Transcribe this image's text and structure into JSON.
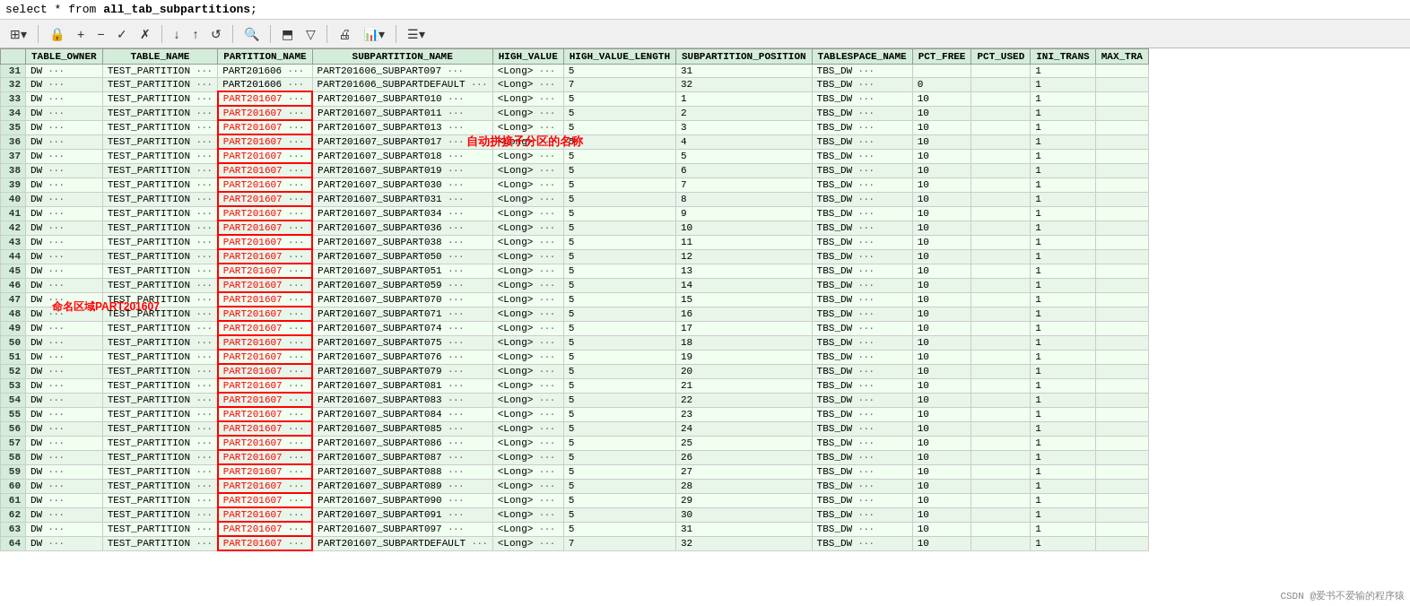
{
  "sql": {
    "text": "select * from all_tab_subpartitions;"
  },
  "toolbar": {
    "buttons": [
      {
        "id": "grid-btn",
        "icon": "⊞",
        "label": "grid"
      },
      {
        "id": "lock-btn",
        "icon": "🔒",
        "label": "lock"
      },
      {
        "id": "add-btn",
        "icon": "+",
        "label": "add"
      },
      {
        "id": "minus-btn",
        "icon": "−",
        "label": "minus"
      },
      {
        "id": "check-btn",
        "icon": "✓",
        "label": "check"
      },
      {
        "id": "x-btn",
        "icon": "✗",
        "label": "cancel"
      },
      {
        "id": "down-arr",
        "icon": "↓",
        "label": "down"
      },
      {
        "id": "up-arr",
        "icon": "↑",
        "label": "up"
      },
      {
        "id": "refresh-btn",
        "icon": "↺",
        "label": "refresh"
      },
      {
        "id": "search-btn",
        "icon": "🔍",
        "label": "search"
      },
      {
        "id": "export-btn",
        "icon": "⬒",
        "label": "export"
      },
      {
        "id": "filter-btn",
        "icon": "▽",
        "label": "filter"
      },
      {
        "id": "print-btn",
        "icon": "🖨",
        "label": "print"
      },
      {
        "id": "chart-btn",
        "icon": "📊",
        "label": "chart"
      },
      {
        "id": "settings-btn",
        "icon": "☰",
        "label": "settings"
      }
    ]
  },
  "columns": [
    "",
    "TABLE_OWNER",
    "TABLE_NAME",
    "PARTITION_NAME",
    "SUBPARTITION_NAME",
    "HIGH_VALUE",
    "HIGH_VALUE_LENGTH",
    "SUBPARTITION_POSITION",
    "TABLESPACE_NAME",
    "PCT_FREE",
    "PCT_USED",
    "INI_TRANS",
    "MAX_TRA"
  ],
  "annotation": {
    "auto_concat_label": "自动拼接子分区的名称",
    "partition_label": "命名区域PART201607",
    "highlight_partition": "PART201607"
  },
  "rows": [
    {
      "num": 31,
      "owner": "DW",
      "table_name": "TEST_PARTITION",
      "partition": "PART201606",
      "subpartition": "PART201606_SUBPART097",
      "high_value": "<Long>",
      "hvl": 5,
      "pos": 31,
      "ts": "TBS_DW",
      "pct_free": "",
      "pct_used": "",
      "ini": 1,
      "max": ""
    },
    {
      "num": 32,
      "owner": "DW",
      "table_name": "TEST_PARTITION",
      "partition": "PART201606",
      "subpartition": "PART201606_SUBPARTDEFAULT",
      "high_value": "<Long>",
      "hvl": 7,
      "pos": 32,
      "ts": "TBS_DW",
      "pct_free": 0,
      "pct_used": "",
      "ini": 1,
      "max": ""
    },
    {
      "num": 33,
      "owner": "DW",
      "table_name": "TEST_PARTITION",
      "partition": "PART201607",
      "subpartition": "PART201607_SUBPART010",
      "high_value": "<Long>",
      "hvl": 5,
      "pos": 1,
      "ts": "TBS_DW",
      "pct_free": 10,
      "pct_used": "",
      "ini": 1,
      "max": ""
    },
    {
      "num": 34,
      "owner": "DW",
      "table_name": "TEST_PARTITION",
      "partition": "PART201607",
      "subpartition": "PART201607_SUBPART011",
      "high_value": "<Long>",
      "hvl": 5,
      "pos": 2,
      "ts": "TBS_DW",
      "pct_free": 10,
      "pct_used": "",
      "ini": 1,
      "max": ""
    },
    {
      "num": 35,
      "owner": "DW",
      "table_name": "TEST_PARTITION",
      "partition": "PART201607",
      "subpartition": "PART201607_SUBPART013",
      "high_value": "<Long>",
      "hvl": 5,
      "pos": 3,
      "ts": "TBS_DW",
      "pct_free": 10,
      "pct_used": "",
      "ini": 1,
      "max": ""
    },
    {
      "num": 36,
      "owner": "DW",
      "table_name": "TEST_PARTITION",
      "partition": "PART201607",
      "subpartition": "PART201607_SUBPART017",
      "high_value": "<Long>",
      "hvl": 5,
      "pos": 4,
      "ts": "TBS_DW",
      "pct_free": 10,
      "pct_used": "",
      "ini": 1,
      "max": ""
    },
    {
      "num": 37,
      "owner": "DW",
      "table_name": "TEST_PARTITION",
      "partition": "PART201607",
      "subpartition": "PART201607_SUBPART018",
      "high_value": "<Long>",
      "hvl": 5,
      "pos": 5,
      "ts": "TBS_DW",
      "pct_free": 10,
      "pct_used": "",
      "ini": 1,
      "max": ""
    },
    {
      "num": 38,
      "owner": "DW",
      "table_name": "TEST_PARTITION",
      "partition": "PART201607",
      "subpartition": "PART201607_SUBPART019",
      "high_value": "<Long>",
      "hvl": 5,
      "pos": 6,
      "ts": "TBS_DW",
      "pct_free": 10,
      "pct_used": "",
      "ini": 1,
      "max": ""
    },
    {
      "num": 39,
      "owner": "DW",
      "table_name": "TEST_PARTITION",
      "partition": "PART201607",
      "subpartition": "PART201607_SUBPART030",
      "high_value": "<Long>",
      "hvl": 5,
      "pos": 7,
      "ts": "TBS_DW",
      "pct_free": 10,
      "pct_used": "",
      "ini": 1,
      "max": ""
    },
    {
      "num": 40,
      "owner": "DW",
      "table_name": "TEST_PARTITION",
      "partition": "PART201607",
      "subpartition": "PART201607_SUBPART031",
      "high_value": "<Long>",
      "hvl": 5,
      "pos": 8,
      "ts": "TBS_DW",
      "pct_free": 10,
      "pct_used": "",
      "ini": 1,
      "max": ""
    },
    {
      "num": 41,
      "owner": "DW",
      "table_name": "TEST_PARTITION",
      "partition": "PART201607",
      "subpartition": "PART201607_SUBPART034",
      "high_value": "<Long>",
      "hvl": 5,
      "pos": 9,
      "ts": "TBS_DW",
      "pct_free": 10,
      "pct_used": "",
      "ini": 1,
      "max": ""
    },
    {
      "num": 42,
      "owner": "DW",
      "table_name": "TEST_PARTITION",
      "partition": "PART201607",
      "subpartition": "PART201607_SUBPART036",
      "high_value": "<Long>",
      "hvl": 5,
      "pos": 10,
      "ts": "TBS_DW",
      "pct_free": 10,
      "pct_used": "",
      "ini": 1,
      "max": ""
    },
    {
      "num": 43,
      "owner": "DW",
      "table_name": "TEST_PARTITION",
      "partition": "PART201607",
      "subpartition": "PART201607_SUBPART038",
      "high_value": "<Long>",
      "hvl": 5,
      "pos": 11,
      "ts": "TBS_DW",
      "pct_free": 10,
      "pct_used": "",
      "ini": 1,
      "max": ""
    },
    {
      "num": 44,
      "owner": "DW",
      "table_name": "TEST_PARTITION",
      "partition": "PART201607",
      "subpartition": "PART201607_SUBPART050",
      "high_value": "<Long>",
      "hvl": 5,
      "pos": 12,
      "ts": "TBS_DW",
      "pct_free": 10,
      "pct_used": "",
      "ini": 1,
      "max": ""
    },
    {
      "num": 45,
      "owner": "DW",
      "table_name": "TEST_PARTITION",
      "partition": "PART201607",
      "subpartition": "PART201607_SUBPART051",
      "high_value": "<Long>",
      "hvl": 5,
      "pos": 13,
      "ts": "TBS_DW",
      "pct_free": 10,
      "pct_used": "",
      "ini": 1,
      "max": ""
    },
    {
      "num": 46,
      "owner": "DW",
      "table_name": "TEST_PARTITION",
      "partition": "PART201607",
      "subpartition": "PART201607_SUBPART059",
      "high_value": "<Long>",
      "hvl": 5,
      "pos": 14,
      "ts": "TBS_DW",
      "pct_free": 10,
      "pct_used": "",
      "ini": 1,
      "max": ""
    },
    {
      "num": 47,
      "owner": "DW",
      "table_name": "TEST_PARTITION",
      "partition": "PART201607",
      "subpartition": "PART201607_SUBPART070",
      "high_value": "<Long>",
      "hvl": 5,
      "pos": 15,
      "ts": "TBS_DW",
      "pct_free": 10,
      "pct_used": "",
      "ini": 1,
      "max": ""
    },
    {
      "num": 48,
      "owner": "DW",
      "table_name": "TEST_PARTITION",
      "partition": "PART201607",
      "subpartition": "PART201607_SUBPART071",
      "high_value": "<Long>",
      "hvl": 5,
      "pos": 16,
      "ts": "TBS_DW",
      "pct_free": 10,
      "pct_used": "",
      "ini": 1,
      "max": ""
    },
    {
      "num": 49,
      "owner": "DW",
      "table_name": "TEST_PARTITION",
      "partition": "PART201607",
      "subpartition": "PART201607_SUBPART074",
      "high_value": "<Long>",
      "hvl": 5,
      "pos": 17,
      "ts": "TBS_DW",
      "pct_free": 10,
      "pct_used": "",
      "ini": 1,
      "max": ""
    },
    {
      "num": 50,
      "owner": "DW",
      "table_name": "TEST_PARTITION",
      "partition": "PART201607",
      "subpartition": "PART201607_SUBPART075",
      "high_value": "<Long>",
      "hvl": 5,
      "pos": 18,
      "ts": "TBS_DW",
      "pct_free": 10,
      "pct_used": "",
      "ini": 1,
      "max": ""
    },
    {
      "num": 51,
      "owner": "DW",
      "table_name": "TEST_PARTITION",
      "partition": "PART201607",
      "subpartition": "PART201607_SUBPART076",
      "high_value": "<Long>",
      "hvl": 5,
      "pos": 19,
      "ts": "TBS_DW",
      "pct_free": 10,
      "pct_used": "",
      "ini": 1,
      "max": ""
    },
    {
      "num": 52,
      "owner": "DW",
      "table_name": "TEST_PARTITION",
      "partition": "PART201607",
      "subpartition": "PART201607_SUBPART079",
      "high_value": "<Long>",
      "hvl": 5,
      "pos": 20,
      "ts": "TBS_DW",
      "pct_free": 10,
      "pct_used": "",
      "ini": 1,
      "max": ""
    },
    {
      "num": 53,
      "owner": "DW",
      "table_name": "TEST_PARTITION",
      "partition": "PART201607",
      "subpartition": "PART201607_SUBPART081",
      "high_value": "<Long>",
      "hvl": 5,
      "pos": 21,
      "ts": "TBS_DW",
      "pct_free": 10,
      "pct_used": "",
      "ini": 1,
      "max": ""
    },
    {
      "num": 54,
      "owner": "DW",
      "table_name": "TEST_PARTITION",
      "partition": "PART201607",
      "subpartition": "PART201607_SUBPART083",
      "high_value": "<Long>",
      "hvl": 5,
      "pos": 22,
      "ts": "TBS_DW",
      "pct_free": 10,
      "pct_used": "",
      "ini": 1,
      "max": ""
    },
    {
      "num": 55,
      "owner": "DW",
      "table_name": "TEST_PARTITION",
      "partition": "PART201607",
      "subpartition": "PART201607_SUBPART084",
      "high_value": "<Long>",
      "hvl": 5,
      "pos": 23,
      "ts": "TBS_DW",
      "pct_free": 10,
      "pct_used": "",
      "ini": 1,
      "max": ""
    },
    {
      "num": 56,
      "owner": "DW",
      "table_name": "TEST_PARTITION",
      "partition": "PART201607",
      "subpartition": "PART201607_SUBPART085",
      "high_value": "<Long>",
      "hvl": 5,
      "pos": 24,
      "ts": "TBS_DW",
      "pct_free": 10,
      "pct_used": "",
      "ini": 1,
      "max": ""
    },
    {
      "num": 57,
      "owner": "DW",
      "table_name": "TEST_PARTITION",
      "partition": "PART201607",
      "subpartition": "PART201607_SUBPART086",
      "high_value": "<Long>",
      "hvl": 5,
      "pos": 25,
      "ts": "TBS_DW",
      "pct_free": 10,
      "pct_used": "",
      "ini": 1,
      "max": ""
    },
    {
      "num": 58,
      "owner": "DW",
      "table_name": "TEST_PARTITION",
      "partition": "PART201607",
      "subpartition": "PART201607_SUBPART087",
      "high_value": "<Long>",
      "hvl": 5,
      "pos": 26,
      "ts": "TBS_DW",
      "pct_free": 10,
      "pct_used": "",
      "ini": 1,
      "max": ""
    },
    {
      "num": 59,
      "owner": "DW",
      "table_name": "TEST_PARTITION",
      "partition": "PART201607",
      "subpartition": "PART201607_SUBPART088",
      "high_value": "<Long>",
      "hvl": 5,
      "pos": 27,
      "ts": "TBS_DW",
      "pct_free": 10,
      "pct_used": "",
      "ini": 1,
      "max": ""
    },
    {
      "num": 60,
      "owner": "DW",
      "table_name": "TEST_PARTITION",
      "partition": "PART201607",
      "subpartition": "PART201607_SUBPART089",
      "high_value": "<Long>",
      "hvl": 5,
      "pos": 28,
      "ts": "TBS_DW",
      "pct_free": 10,
      "pct_used": "",
      "ini": 1,
      "max": ""
    },
    {
      "num": 61,
      "owner": "DW",
      "table_name": "TEST_PARTITION",
      "partition": "PART201607",
      "subpartition": "PART201607_SUBPART090",
      "high_value": "<Long>",
      "hvl": 5,
      "pos": 29,
      "ts": "TBS_DW",
      "pct_free": 10,
      "pct_used": "",
      "ini": 1,
      "max": ""
    },
    {
      "num": 62,
      "owner": "DW",
      "table_name": "TEST_PARTITION",
      "partition": "PART201607",
      "subpartition": "PART201607_SUBPART091",
      "high_value": "<Long>",
      "hvl": 5,
      "pos": 30,
      "ts": "TBS_DW",
      "pct_free": 10,
      "pct_used": "",
      "ini": 1,
      "max": ""
    },
    {
      "num": 63,
      "owner": "DW",
      "table_name": "TEST_PARTITION",
      "partition": "PART201607",
      "subpartition": "PART201607_SUBPART097",
      "high_value": "<Long>",
      "hvl": 5,
      "pos": 31,
      "ts": "TBS_DW",
      "pct_free": 10,
      "pct_used": "",
      "ini": 1,
      "max": ""
    },
    {
      "num": 64,
      "owner": "DW",
      "table_name": "TEST_PARTITION",
      "partition": "PART201607",
      "subpartition": "PART201607_SUBPARTDEFAULT",
      "high_value": "<Long>",
      "hvl": 7,
      "pos": 32,
      "ts": "TBS_DW",
      "pct_free": 10,
      "pct_used": "",
      "ini": 1,
      "max": ""
    }
  ],
  "watermark": "CSDN @爱书不爱输的程序猿"
}
